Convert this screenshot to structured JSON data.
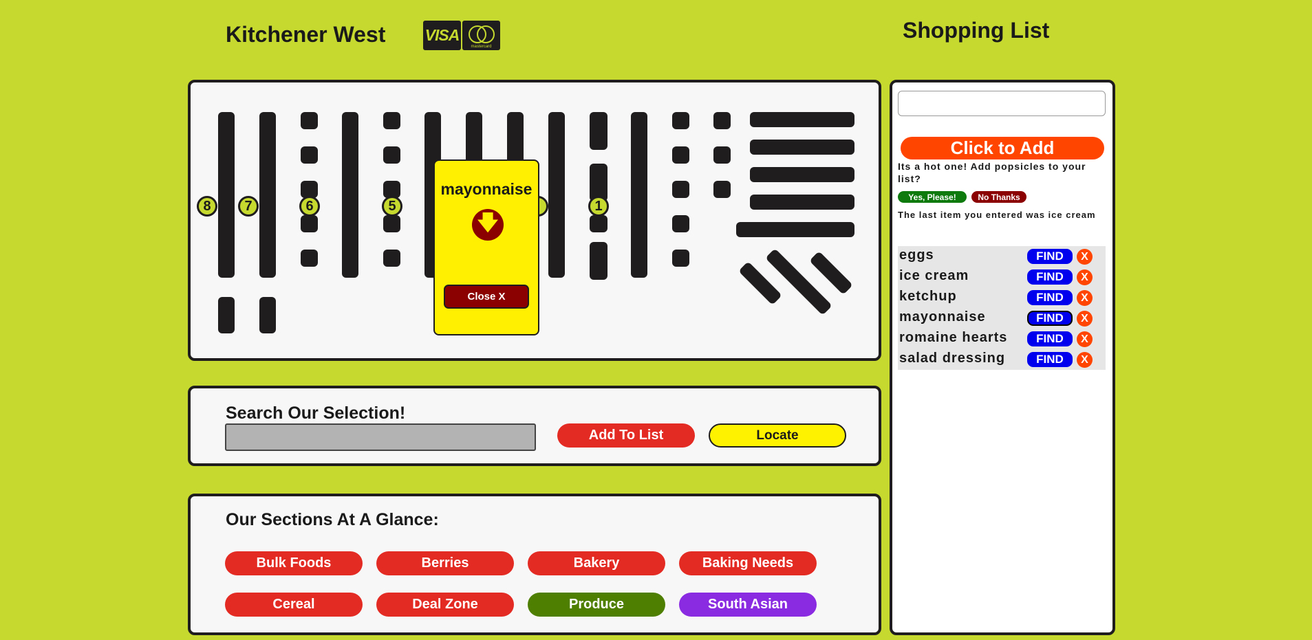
{
  "header": {
    "store_name": "Kitchener West",
    "payment_cards": [
      "VISA",
      "mastercard"
    ],
    "list_title": "Shopping List"
  },
  "colors": {
    "background": "#c5d92e",
    "panel": "#f7f7f7",
    "shelf": "#1f1d1e",
    "primary_red": "#e42b23",
    "locate_yellow": "#fff200",
    "produce_green": "#4f7f00",
    "south_asian_purple": "#8a2be2",
    "find_blue": "#0000ee",
    "remove_orange": "#ff4500"
  },
  "map": {
    "aisle_numbers": [
      "8",
      "7",
      "6",
      "5",
      "1"
    ],
    "popup": {
      "item": "mayonnaise",
      "icon": "down-arrow-icon",
      "close_label": "Close X"
    }
  },
  "search": {
    "heading": "Search Our Selection!",
    "input_value": "",
    "add_label": "Add To List",
    "locate_label": "Locate"
  },
  "sections": {
    "heading": "Our Sections At A Glance:",
    "buttons": [
      {
        "label": "Bulk Foods"
      },
      {
        "label": "Berries"
      },
      {
        "label": "Bakery"
      },
      {
        "label": "Baking Needs"
      },
      {
        "label": "Cereal"
      },
      {
        "label": "Deal Zone"
      },
      {
        "label": "Produce"
      },
      {
        "label": "South Asian"
      }
    ]
  },
  "shopping_list": {
    "input_value": "",
    "click_to_add": "Click to Add",
    "promo_text": "Its a hot one! Add popsicles to your list?",
    "yes_label": "Yes, Please!",
    "no_label": "No Thanks",
    "last_item_text": "The last item you entered was ice cream",
    "find_label": "FIND",
    "remove_label": "X",
    "items": [
      "eggs",
      "ice cream",
      "ketchup",
      "mayonnaise",
      "romaine hearts",
      "salad dressing"
    ]
  }
}
